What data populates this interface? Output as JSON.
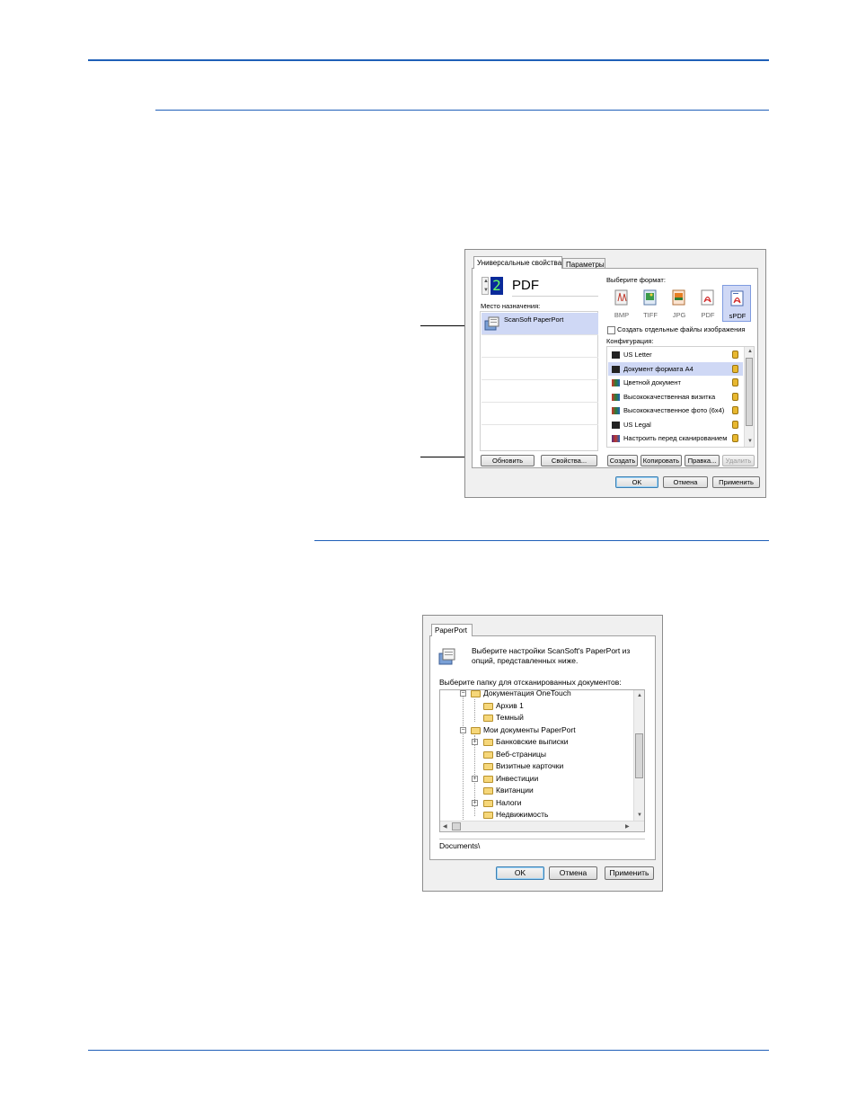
{
  "dialog_properties": {
    "tabs": [
      "Универсальные свойства",
      "Параметры"
    ],
    "selected_app": "PDF",
    "selected_number": "2",
    "destination_label": "Место назначения:",
    "destination_item": "ScanSoft PaperPort",
    "format_label": "Выберите формат:",
    "formats": [
      "BMP",
      "TIFF",
      "JPG",
      "PDF",
      "sPDF"
    ],
    "selected_format": "sPDF",
    "separate_files_label": "Создать отдельные файлы изображения",
    "config_label": "Конфигурация:",
    "configs": [
      "US Letter",
      "Документ формата A4",
      "Цветной документ",
      "Высококачественная визитка",
      "Высококачественное фото (6x4)",
      "US Legal",
      "Настроить перед сканированием"
    ],
    "selected_config": "Документ формата A4",
    "buttons": {
      "refresh": "Обновить",
      "properties": "Свойства...",
      "create": "Создать",
      "copy": "Копировать",
      "edit": "Правка...",
      "delete": "Удалить",
      "ok": "OK",
      "cancel": "Отмена",
      "apply": "Применить"
    }
  },
  "dialog_paperport": {
    "tab": "PaperPort",
    "description": "Выберите настройки ScanSoft's PaperPort из опций, представленных ниже.",
    "folder_label": "Выберите папку для отсканированных документов:",
    "tree": [
      {
        "label": "Документация OneTouch",
        "level": 1,
        "expander": "minus"
      },
      {
        "label": "Архив 1",
        "level": 2,
        "expander": ""
      },
      {
        "label": "Темный",
        "level": 2,
        "expander": ""
      },
      {
        "label": "Мои документы PaperPort",
        "level": 1,
        "expander": "minus"
      },
      {
        "label": "Банковские выписки",
        "level": 2,
        "expander": "plus"
      },
      {
        "label": "Веб-страницы",
        "level": 2,
        "expander": ""
      },
      {
        "label": "Визитные карточки",
        "level": 2,
        "expander": ""
      },
      {
        "label": "Инвестиции",
        "level": 2,
        "expander": "plus"
      },
      {
        "label": "Квитанции",
        "level": 2,
        "expander": ""
      },
      {
        "label": "Налоги",
        "level": 2,
        "expander": "plus"
      },
      {
        "label": "Недвижимость",
        "level": 2,
        "expander": ""
      }
    ],
    "path": "Documents\\",
    "buttons": {
      "ok": "OK",
      "cancel": "Отмена",
      "apply": "Применить"
    }
  },
  "colors": {
    "rule": "#1f5fb8",
    "selection": "#cfd8f5",
    "number_display": "#0a2a9a"
  }
}
